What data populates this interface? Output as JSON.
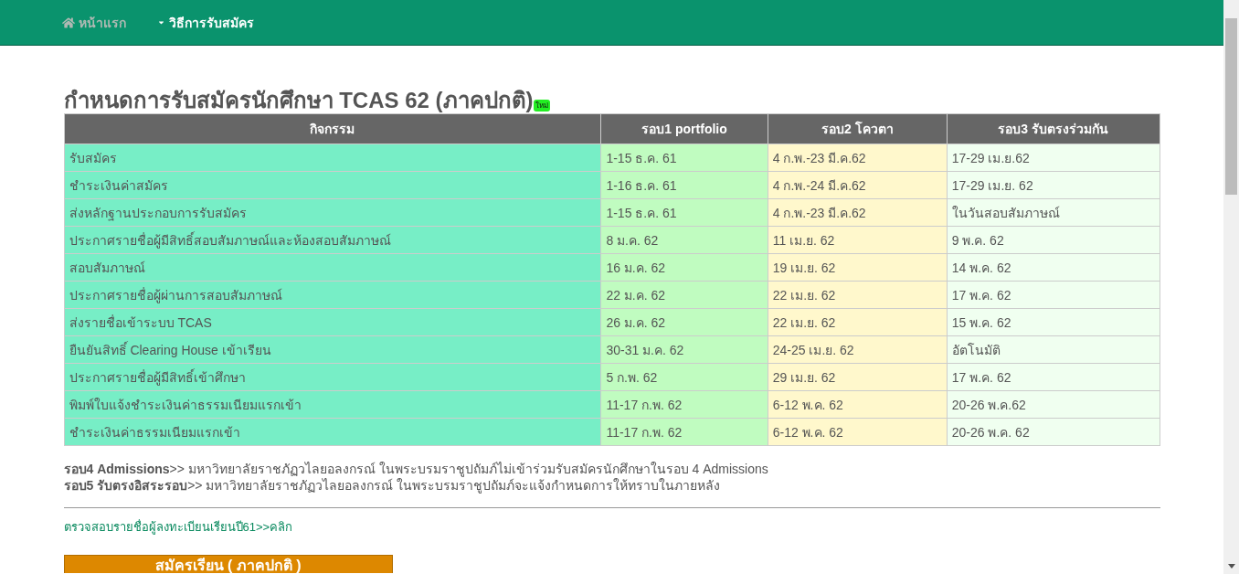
{
  "nav": {
    "items": [
      {
        "label": "หน้าแรก",
        "kind": "home",
        "selected": false
      },
      {
        "label": "วิธีการรับสมัคร",
        "kind": "dropdown",
        "selected": true
      }
    ]
  },
  "title": "กำหนดการรับสมัครนักศึกษา TCAS 62 (ภาคปกติ)",
  "badge": "ใหม่",
  "table": {
    "columns": [
      "กิจกรรม",
      "รอบ1 portfolio",
      "รอบ2 โควตา",
      "รอบ3 รับตรงร่วมกัน"
    ],
    "rows": [
      [
        "รับสมัคร",
        "1-15 ธ.ค. 61",
        "4 ก.พ.-23 มี.ค.62",
        "17-29 เม.ย.62"
      ],
      [
        "ชำระเงินค่าสมัคร",
        "1-16 ธ.ค. 61",
        "4 ก.พ.-24 มี.ค.62",
        "17-29 เม.ย. 62"
      ],
      [
        "ส่งหลักฐานประกอบการรับสมัคร",
        "1-15 ธ.ค. 61",
        "4 ก.พ.-23 มี.ค.62",
        "ในวันสอบสัมภาษณ์"
      ],
      [
        "ประกาศรายชื่อผู้มีสิทธิ์สอบสัมภาษณ์และห้องสอบสัมภาษณ์",
        "8 ม.ค. 62",
        "11 เม.ย. 62",
        "9 พ.ค. 62"
      ],
      [
        "สอบสัมภาษณ์",
        "16 ม.ค. 62",
        "19 เม.ย. 62",
        "14 พ.ค. 62"
      ],
      [
        "ประกาศรายชื่อผู้ผ่านการสอบสัมภาษณ์",
        "22 ม.ค. 62",
        "22 เม.ย. 62",
        "17 พ.ค. 62"
      ],
      [
        "ส่งรายชื่อเข้าระบบ TCAS",
        "26 ม.ค. 62",
        "22 เม.ย. 62",
        "15 พ.ค. 62"
      ],
      [
        "ยืนยันสิทธิ์ Clearing House เข้าเรียน",
        "30-31 ม.ค. 62",
        "24-25 เม.ย. 62",
        "อัตโนมัติ"
      ],
      [
        "ประกาศรายชื่อผู้มีสิทธิ์เข้าศึกษา",
        "5 ก.พ. 62",
        "29 เม.ย. 62",
        "17 พ.ค. 62"
      ],
      [
        "พิมพ์ใบแจ้งชำระเงินค่าธรรมเนียมแรกเข้า",
        "11-17 ก.พ. 62",
        "6-12 พ.ค. 62",
        "20-26 พ.ค.62"
      ],
      [
        "ชำระเงินค่าธรรมเนียมแรกเข้า",
        "11-17 ก.พ. 62",
        "6-12 พ.ค. 62",
        "20-26 พ.ค. 62"
      ]
    ]
  },
  "notes": [
    "**รอบ4 Admissions**>> มหาวิทยาลัยราชภัฏวไลยอลงกรณ์ ในพระบรมราชูปถัมภ์ไม่เข้าร่วมรับสมัครนักศึกษาในรอบ 4 Admissions",
    "**รอบ5 รับตรงอิสระรอบ**>> มหาวิทยาลัยราชภัฏวไลยอลงกรณ์ ในพระบรมราชูปถัมภ์จะแจ้งกำหนดการให้ทราบในภายหลัง"
  ],
  "link": "ตรวจสอบรายชื่อผู้ลงทะเบียนเรียนปี61>>คลิก",
  "apply_button": "สมัครเรียน ( ภาคปกติ )"
}
